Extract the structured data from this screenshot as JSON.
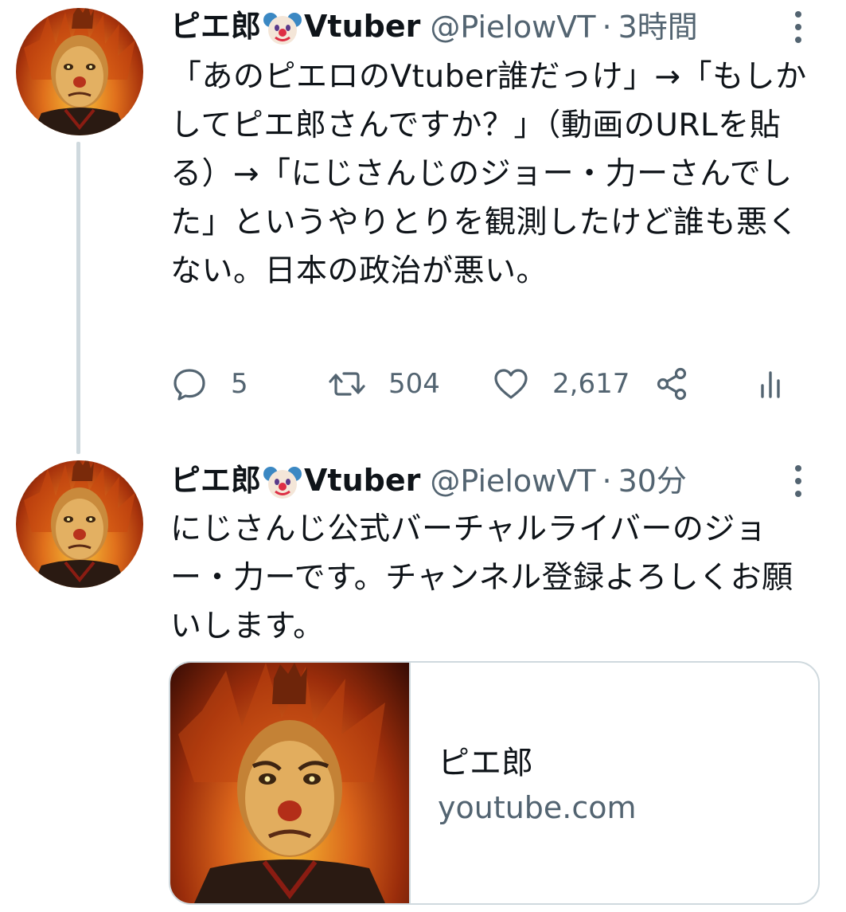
{
  "tweets": [
    {
      "display_name_prefix": "ピエ郎",
      "display_name_suffix": "Vtuber",
      "handle": "@PielowVT",
      "separator": "·",
      "time": "3時間",
      "text": "「あのピエロのVtuber誰だっけ」→「もしかしてピエ郎さんですか？」（動画のURLを貼る）→「にじさんじのジョー・力ーさんでした」というやりとりを観測したけど誰も悪くない。日本の政治が悪い。",
      "replies": "5",
      "retweets": "504",
      "likes": "2,617"
    },
    {
      "display_name_prefix": "ピエ郎",
      "display_name_suffix": "Vtuber",
      "handle": "@PielowVT",
      "separator": "·",
      "time": "30分",
      "text": "にじさんじ公式バーチャルライバーのジョー・力ーです。チャンネル登録よろしくお願いします。",
      "card": {
        "title": "ピエ郎",
        "domain": "youtube.com"
      }
    }
  ],
  "colors": {
    "text_primary": "#0f1419",
    "text_secondary": "#536471",
    "border": "#cfd9de",
    "background": "#ffffff"
  },
  "icons": {
    "display_name_emoji": "clown-face-icon",
    "more": "more-vertical-icon",
    "reply": "reply-icon",
    "retweet": "retweet-icon",
    "like": "heart-icon",
    "share": "share-icon",
    "analytics": "analytics-icon"
  }
}
